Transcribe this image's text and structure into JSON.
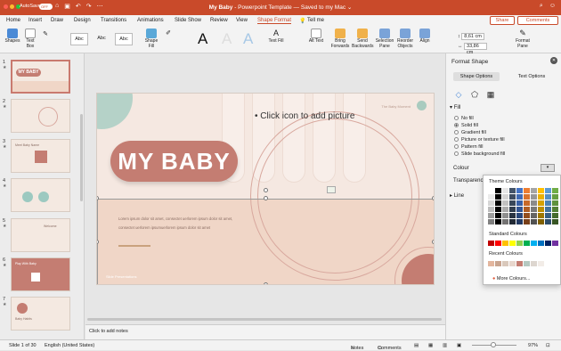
{
  "titlebar": {
    "autosave_label": "AutoSave",
    "autosave_state": "OFF",
    "doc_name": "My Baby",
    "doc_suffix": " - Powerpoint Template — Saved to my Mac ⌄"
  },
  "tabs": [
    "Home",
    "Insert",
    "Draw",
    "Design",
    "Transitions",
    "Animations",
    "Slide Show",
    "Review",
    "View",
    "Shape Format",
    "Tell me"
  ],
  "active_tab": "Shape Format",
  "share_label": "Share",
  "comments_label": "Comments",
  "ribbon": {
    "shapes": "Shapes",
    "text_box": "Text Box",
    "shape_fill": "Shape Fill",
    "text_fill": "Text Fill",
    "alt_text": "Alt Text",
    "bring_forwards": "Bring Forwards",
    "send_backwards": "Send Backwards",
    "selection_pane": "Selection Pane",
    "reorder_objects": "Reorder Objects",
    "align": "Align",
    "format_pane": "Format Pane",
    "style_label": "Abc",
    "wordart": "A",
    "height": "8,61 cm",
    "width": "33,86 cm"
  },
  "thumbs": [
    {
      "n": "1",
      "title": "MY BABY"
    },
    {
      "n": "2",
      "title": ""
    },
    {
      "n": "3",
      "title": "Meet Baby Name"
    },
    {
      "n": "4",
      "title": ""
    },
    {
      "n": "5",
      "title": "Welcome"
    },
    {
      "n": "6",
      "title": "Play With Baby"
    },
    {
      "n": "7",
      "title": "Baby Habits"
    }
  ],
  "slide": {
    "title": "MY BABY",
    "placeholder": "• Click icon to add picture",
    "body": "Lorem ipsum dolor sit amet, consectet uerlorem ipsum dolor sit amet, consectet uerlorem ipsumuerlorem ipsum dolor sit amet",
    "brand": "Slide Presentations",
    "author": "The Baby Moment"
  },
  "notes": "Click to add notes",
  "status": {
    "slide": "Slide 1 of 30",
    "lang": "English (United States)",
    "notes": "Notes",
    "comments": "Comments",
    "zoom": "97%"
  },
  "pane": {
    "title": "Format Shape",
    "tab1": "Shape Options",
    "tab2": "Text Options",
    "fill": "Fill",
    "options": [
      "No fill",
      "Solid fill",
      "Gradient fill",
      "Picture or texture fill",
      "Pattern fill",
      "Slide background fill"
    ],
    "selected_option": "Solid fill",
    "colour": "Colour",
    "transparency": "Transparency",
    "line": "Line"
  },
  "popup": {
    "theme": "Theme Colours",
    "standard": "Standard Colours",
    "recent": "Recent Colours",
    "more": "More Colours...",
    "theme_row": [
      "#ffffff",
      "#000000",
      "#e7e6e6",
      "#44546a",
      "#4472c4",
      "#ed7d31",
      "#a5a5a5",
      "#ffc000",
      "#5b9bd5",
      "#70ad47"
    ],
    "standard_row": [
      "#c00000",
      "#ff0000",
      "#ffc000",
      "#ffff00",
      "#92d050",
      "#00b050",
      "#00b0f0",
      "#0070c0",
      "#002060",
      "#7030a0"
    ],
    "recent_row": [
      "#e3b69e",
      "#c9a48f",
      "#d9c8bb",
      "#e8d7cd",
      "#c47d72",
      "#b5c9c1",
      "#ddd6cf",
      "#f2ece7"
    ]
  },
  "colors": {
    "accent": "#c94a2a",
    "slide_bg": "#f5e8e1",
    "pill": "#c47d72",
    "tan": "#f0d6c7"
  }
}
